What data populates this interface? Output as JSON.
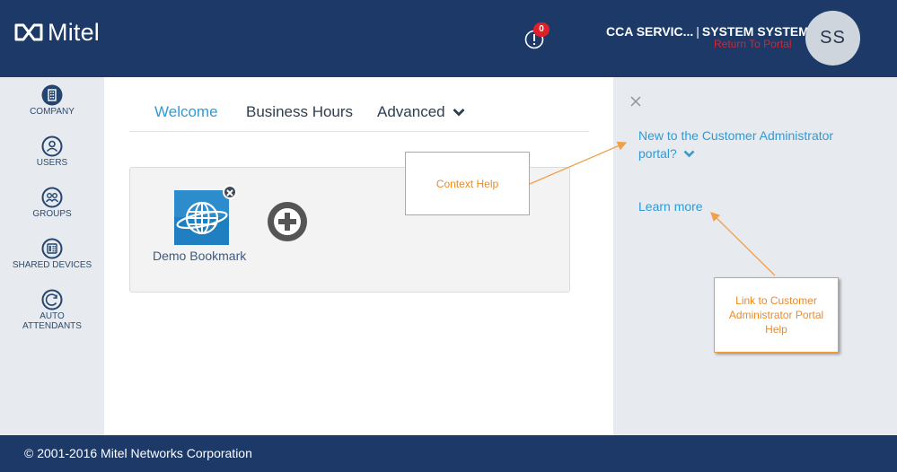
{
  "header": {
    "brand": "Mitel",
    "alert_count": "0",
    "user_text": "CCA SERVIC...",
    "user_separator": "|",
    "user_name": "SYSTEM SYSTEM",
    "return_link": "Return To Portal",
    "avatar_initials": "SS"
  },
  "sidebar": {
    "items": [
      {
        "label": "COMPANY",
        "icon": "building-icon"
      },
      {
        "label": "USERS",
        "icon": "user-icon"
      },
      {
        "label": "GROUPS",
        "icon": "group-icon"
      },
      {
        "label": "SHARED DEVICES",
        "icon": "device-icon"
      },
      {
        "label": "AUTO ATTENDANTS",
        "icon": "auto-attendant-icon"
      }
    ]
  },
  "tabs": [
    {
      "label": "Welcome",
      "active": true
    },
    {
      "label": "Business Hours",
      "active": false
    },
    {
      "label": "Advanced",
      "active": false,
      "icon": "chevron-down-icon"
    }
  ],
  "bookmarks": [
    {
      "label": "Demo Bookmark",
      "icon": "globe-icon"
    }
  ],
  "help": {
    "question": "New to the Customer Administrator portal?",
    "learn_more": "Learn more"
  },
  "callouts": {
    "context_help": "Context Help",
    "link_help": "Link to Customer Administrator Portal Help"
  },
  "footer": {
    "copyright": "© 2001-2016 Mitel Networks Corporation"
  },
  "colors": {
    "navy": "#1c3967",
    "accent_blue": "#2f9bd6",
    "alert_red": "#e01f26",
    "callout_orange": "#ef8a22",
    "panel_grey": "#e7eaee"
  }
}
